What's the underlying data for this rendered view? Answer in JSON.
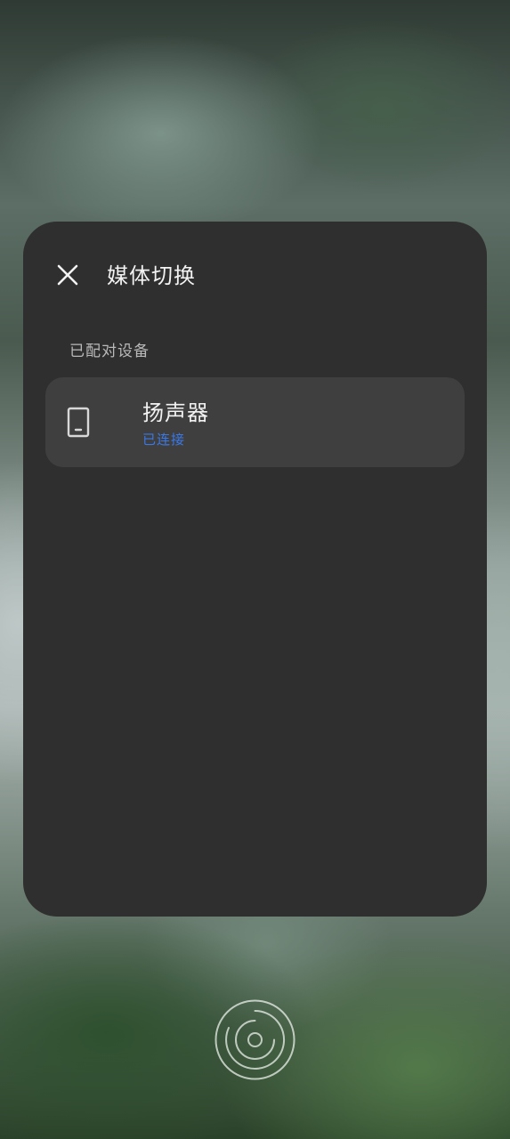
{
  "colors": {
    "sheet_background": "#2f2f2f",
    "card_background": "#3f3f3f",
    "title_text": "#f2f2f2",
    "label_text": "#b9b9b9",
    "status_accent": "#3b78e7"
  },
  "header": {
    "close_icon": "close-icon",
    "title": "媒体切换"
  },
  "paired_devices": {
    "section_label": "已配对设备",
    "items": [
      {
        "icon": "phone-icon",
        "name": "扬声器",
        "status": "已连接"
      }
    ]
  },
  "navigation": {
    "home_icon": "home-fingerprint-icon"
  }
}
